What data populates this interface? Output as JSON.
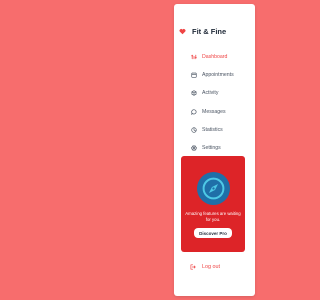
{
  "colors": {
    "background": "#f76d6d",
    "sidebar": "#ffffff",
    "accent": "#ef4444",
    "promo_card": "#dd2428",
    "promo_badge": "#1f6fa8",
    "compass_ring": "#4ec9e6"
  },
  "brand": {
    "icon": "heart-icon",
    "name": "Fit & Fine"
  },
  "nav": {
    "items": [
      {
        "label": "Dashboard",
        "icon": "dashboard-icon",
        "active": true
      },
      {
        "label": "Appointments",
        "icon": "calendar-icon",
        "active": false
      },
      {
        "label": "Activity",
        "icon": "activity-icon",
        "active": false
      },
      {
        "label": "Messages",
        "icon": "message-icon",
        "active": false
      },
      {
        "label": "Statistics",
        "icon": "pie-chart-icon",
        "active": false
      },
      {
        "label": "Settings",
        "icon": "gear-icon",
        "active": false
      }
    ]
  },
  "promo": {
    "icon": "compass-icon",
    "text": "Amazing features are waiting for you.",
    "button_label": "Discover Pro"
  },
  "logout": {
    "icon": "logout-icon",
    "label": "Log out"
  }
}
